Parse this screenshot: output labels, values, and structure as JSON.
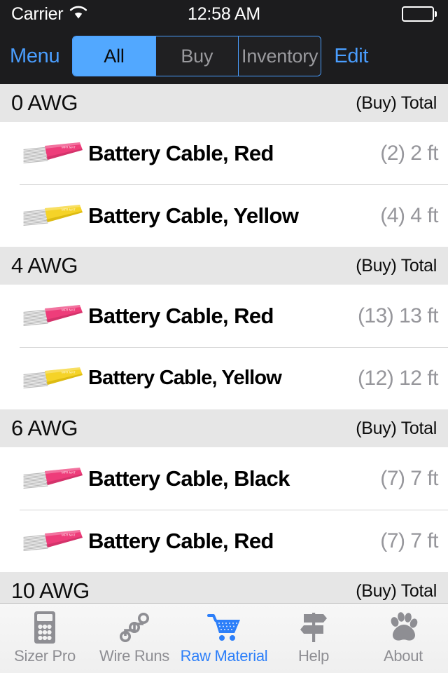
{
  "status_bar": {
    "carrier": "Carrier",
    "wifi_icon": "wifi-icon",
    "time": "12:58 AM",
    "battery_icon": "battery-full-icon"
  },
  "nav": {
    "menu_label": "Menu",
    "edit_label": "Edit",
    "segments": [
      {
        "label": "All",
        "selected": true
      },
      {
        "label": "Buy",
        "selected": false
      },
      {
        "label": "Inventory",
        "selected": false
      }
    ]
  },
  "colors": {
    "accent_blue": "#4a9eff",
    "segment_selected_bg": "#52a8ff",
    "nav_bg": "#1c1c1e",
    "section_header_bg": "#e6e6e6",
    "quantity_gray": "#96969b",
    "tab_active": "#2d7ff9",
    "tab_inactive": "#8e8e93",
    "cable_red": "#ee3d7a",
    "cable_yellow": "#f5d328"
  },
  "list": {
    "sections": [
      {
        "title": "0 AWG",
        "right_label": "(Buy) Total",
        "rows": [
          {
            "thumb": "cable-red-icon",
            "title": "Battery Cable, Red",
            "qty": "(2) 2 ft",
            "shrink": false
          },
          {
            "thumb": "cable-yellow-icon",
            "title": "Battery Cable, Yellow",
            "qty": "(4) 4 ft",
            "shrink": false
          }
        ]
      },
      {
        "title": "4 AWG",
        "right_label": "(Buy) Total",
        "rows": [
          {
            "thumb": "cable-red-icon",
            "title": "Battery Cable, Red",
            "qty": "(13) 13 ft",
            "shrink": false
          },
          {
            "thumb": "cable-yellow-icon",
            "title": "Battery Cable, Yellow",
            "qty": "(12) 12 ft",
            "shrink": true
          }
        ]
      },
      {
        "title": "6 AWG",
        "right_label": "(Buy) Total",
        "rows": [
          {
            "thumb": "cable-red-icon",
            "title": "Battery Cable, Black",
            "qty": "(7) 7 ft",
            "shrink": false
          },
          {
            "thumb": "cable-red-icon",
            "title": "Battery Cable, Red",
            "qty": "(7) 7 ft",
            "shrink": false
          }
        ]
      },
      {
        "title": "10 AWG",
        "right_label": "(Buy) Total",
        "rows": []
      }
    ]
  },
  "tabs": [
    {
      "label": "Sizer Pro",
      "icon": "calculator-icon",
      "active": false
    },
    {
      "label": "Wire Runs",
      "icon": "wire-runs-icon",
      "active": false
    },
    {
      "label": "Raw Material",
      "icon": "shopping-cart-icon",
      "active": true
    },
    {
      "label": "Help",
      "icon": "signpost-icon",
      "active": false
    },
    {
      "label": "About",
      "icon": "paw-print-icon",
      "active": false
    }
  ]
}
